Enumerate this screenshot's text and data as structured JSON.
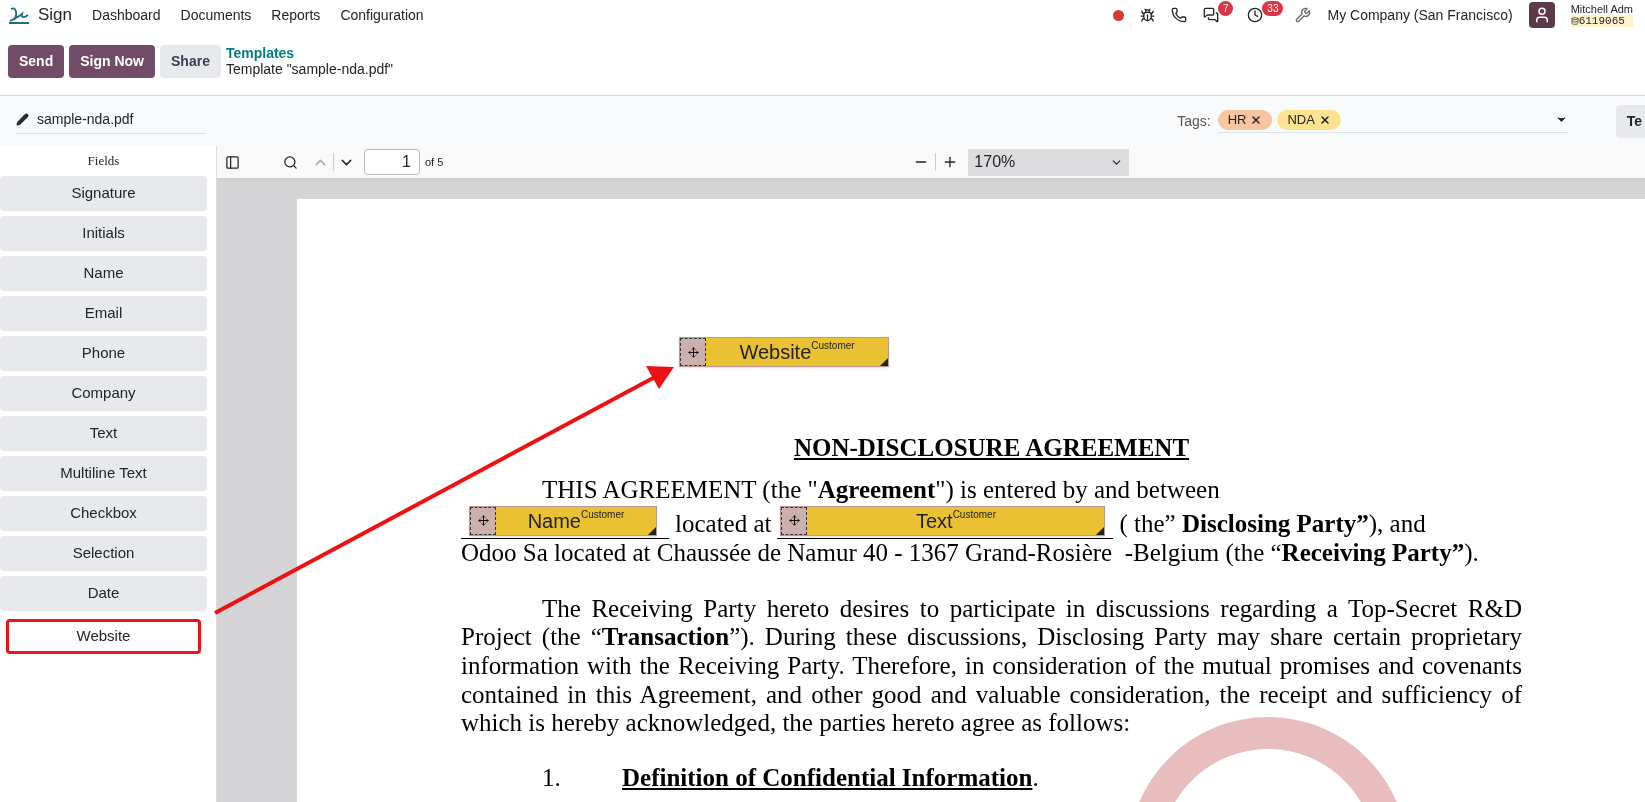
{
  "nav": {
    "app": "Sign",
    "menu": [
      "Dashboard",
      "Documents",
      "Reports",
      "Configuration"
    ],
    "chat_count": "7",
    "activity_count": "33",
    "company": "My Company (San Francisco)",
    "user": "Mitchell Adm",
    "user_code": "6119065"
  },
  "control_panel": {
    "buttons": [
      {
        "label": "Send",
        "kind": "primary"
      },
      {
        "label": "Sign Now",
        "kind": "primary"
      },
      {
        "label": "Share",
        "kind": "secondary"
      }
    ],
    "breadcrumb": "Templates",
    "title": "Template \"sample-nda.pdf\""
  },
  "doc_header": {
    "filename": "sample-nda.pdf",
    "tags_label": "Tags:",
    "tags": [
      {
        "label": "HR",
        "color": "#f7c59f"
      },
      {
        "label": "NDA",
        "color": "#fbe38f"
      }
    ],
    "right_button": "Te"
  },
  "sidebar": {
    "title": "Fields",
    "items": [
      {
        "label": "Signature",
        "highlighted": false
      },
      {
        "label": "Initials",
        "highlighted": false
      },
      {
        "label": "Name",
        "highlighted": false
      },
      {
        "label": "Email",
        "highlighted": false
      },
      {
        "label": "Phone",
        "highlighted": false
      },
      {
        "label": "Company",
        "highlighted": false
      },
      {
        "label": "Text",
        "highlighted": false
      },
      {
        "label": "Multiline Text",
        "highlighted": false
      },
      {
        "label": "Checkbox",
        "highlighted": false
      },
      {
        "label": "Selection",
        "highlighted": false
      },
      {
        "label": "Date",
        "highlighted": false
      },
      {
        "label": "Website",
        "highlighted": true
      }
    ]
  },
  "pdf_toolbar": {
    "page": "1",
    "page_count": "of 5",
    "zoom": "170%"
  },
  "document": {
    "placed_field": {
      "label": "Website",
      "role": "Customer"
    },
    "heading": "NON-DISCLOSURE AGREEMENT",
    "line_1": "THIS AGREEMENT (the \"**Agreement**\") is entered by and between",
    "line_2": {
      "field_1": {
        "label": "Name",
        "role": "Customer"
      },
      "text_1": "located at",
      "field_2": {
        "label": "Text",
        "role": "Customer"
      },
      "text_2": "( the” **Disclosing Party”**), and"
    },
    "line_3": "Odoo Sa located at Chaussée de Namur 40 - 1367 Grand-Rosière  -Belgium (the “**Receiving Party”**).",
    "paragraph": "The Receiving Party hereto desires to participate in discussions regarding a Top-Secret R&D Project (the “**Transaction**”).  During these discussions, Disclosing Party may share certain proprietary information with the Receiving Party.  Therefore, in consideration of the mutual promises and covenants contained in this Agreement, and other good and valuable consideration, the receipt and sufficiency of which is hereby acknowledged, the parties hereto agree as follows:",
    "item": {
      "number": "1.",
      "title": "Definition of Confidential Information",
      "suffix": "."
    }
  }
}
